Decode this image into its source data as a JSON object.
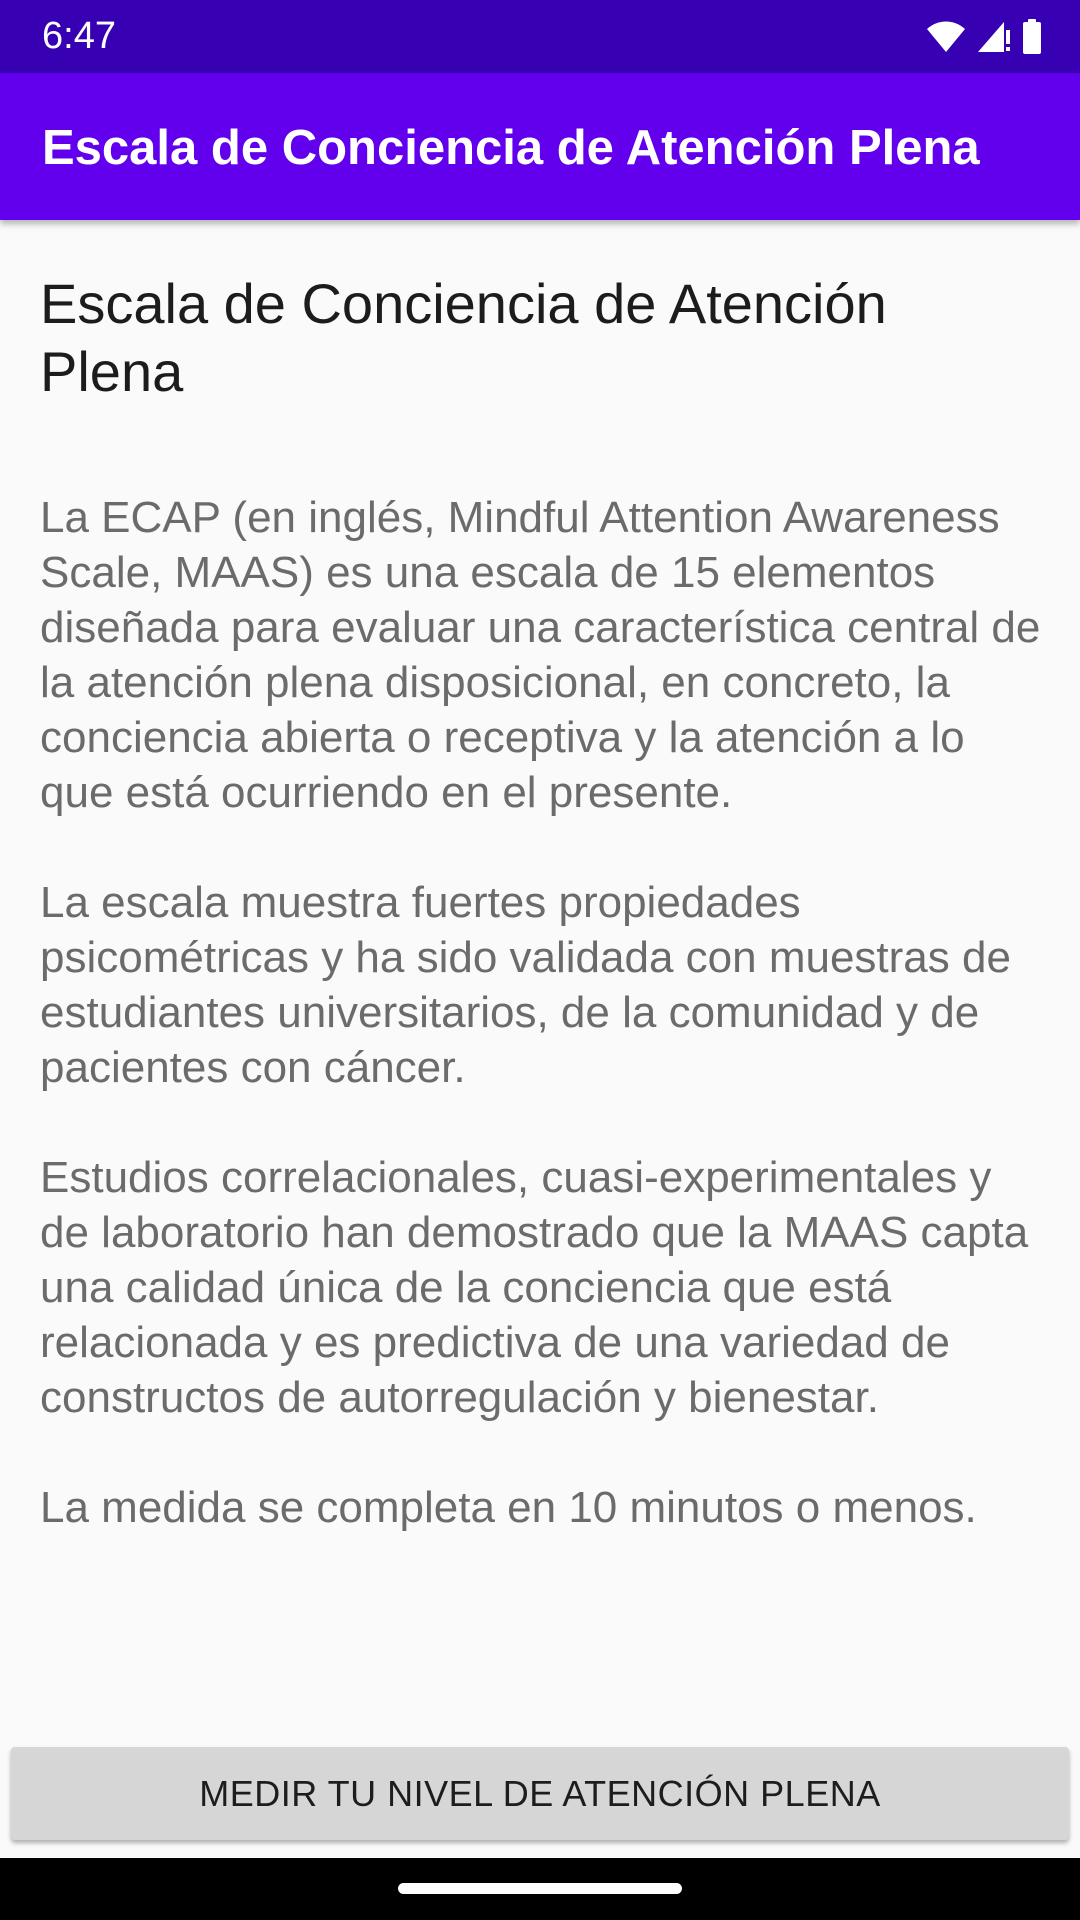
{
  "status_bar": {
    "time": "6:47",
    "icons": [
      "wifi-icon",
      "cell-signal-icon",
      "battery-icon"
    ]
  },
  "app_bar": {
    "title": "Escala de Conciencia de Atención Plena"
  },
  "main": {
    "heading": "Escala de Conciencia de Atención Plena",
    "paragraphs": [
      "La ECAP (en inglés, Mindful Attention Awareness Scale, MAAS) es una escala de 15 elementos diseñada para evaluar una característica central de la atención plena disposicional, en concreto, la conciencia abierta o receptiva y la atención a lo que está ocurriendo en el presente.",
      "La escala muestra fuertes propiedades psicométricas y ha sido validada con muestras de estudiantes universitarios, de la comunidad y de pacientes con cáncer.",
      "Estudios correlacionales, cuasi-experimentales y de laboratorio han demostrado que la MAAS capta una calidad única de la conciencia que está relacionada y es predictiva de una variedad de constructos de autorregulación y bienestar.",
      "La medida se completa en 10 minutos o menos."
    ]
  },
  "action": {
    "button_label": "MEDIR TU NIVEL DE ATENCIÓN PLENA"
  },
  "colors": {
    "status_bar": "#3700b3",
    "app_bar": "#6200ee",
    "background": "#fafafa",
    "button": "#d6d6d6"
  }
}
